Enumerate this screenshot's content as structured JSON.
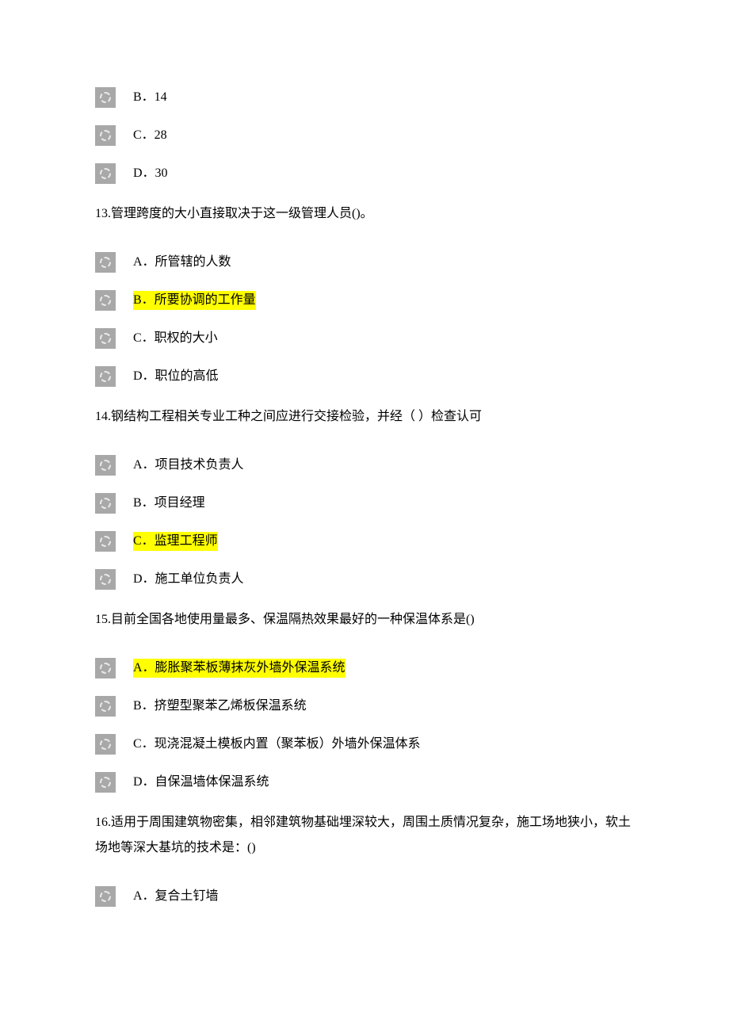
{
  "orphan_options": [
    {
      "label": "B．14"
    },
    {
      "label": "C．28"
    },
    {
      "label": "D．30"
    }
  ],
  "questions": [
    {
      "number": "13",
      "text": "13.管理跨度的大小直接取决于这一级管理人员()。",
      "options": [
        {
          "label": "A．所管辖的人数",
          "highlight": false
        },
        {
          "label": "B．所要协调的工作量",
          "highlight": true
        },
        {
          "label": "C．职权的大小",
          "highlight": false
        },
        {
          "label": "D．职位的高低",
          "highlight": false
        }
      ]
    },
    {
      "number": "14",
      "text": "14.钢结构工程相关专业工种之间应进行交接检验，并经（ ）检查认可",
      "options": [
        {
          "label": "A．项目技术负责人",
          "highlight": false
        },
        {
          "label": "B．项目经理",
          "highlight": false
        },
        {
          "label": "C．监理工程师",
          "highlight": true
        },
        {
          "label": "D．施工单位负责人",
          "highlight": false
        }
      ]
    },
    {
      "number": "15",
      "text": "15.目前全国各地使用量最多、保温隔热效果最好的一种保温体系是()",
      "options": [
        {
          "label": "A．膨胀聚苯板薄抹灰外墙外保温系统",
          "highlight": true
        },
        {
          "label": "B．挤塑型聚苯乙烯板保温系统",
          "highlight": false
        },
        {
          "label": "C．现浇混凝土模板内置（聚苯板）外墙外保温体系",
          "highlight": false
        },
        {
          "label": "D．自保温墙体保温系统",
          "highlight": false
        }
      ]
    },
    {
      "number": "16",
      "text": "16.适用于周围建筑物密集，相邻建筑物基础埋深较大，周围土质情况复杂，施工场地狭小，软土场地等深大基坑的技术是：()",
      "options": [
        {
          "label": "A．复合土钉墙",
          "highlight": false
        }
      ]
    }
  ]
}
